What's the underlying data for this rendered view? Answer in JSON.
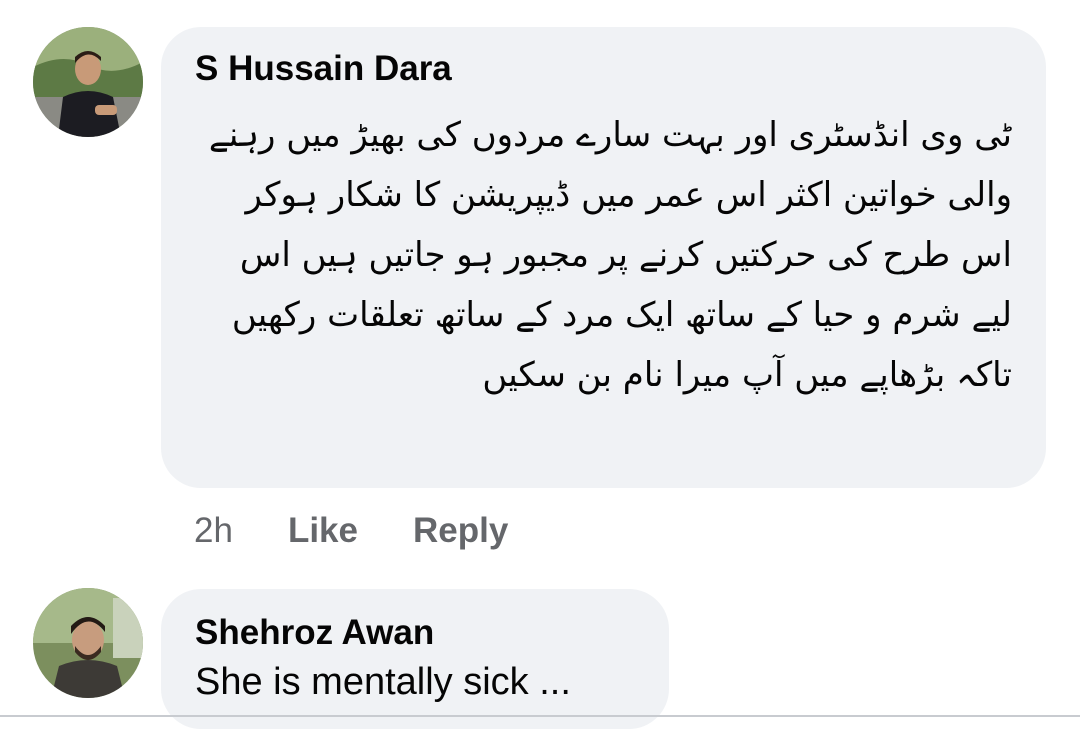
{
  "comments": [
    {
      "author": "S Hussain Dara",
      "text": "ٹی وی انڈسٹری اور بہت سارے مردوں کی بھیڑ میں رہنے والی خواتین اکثر اس عمر میں ڈیپریشن کا شکار ہوکر اس طرح کی حرکتیں کرنے پر مجبور ہو جاتیں ہیں اس لیے شرم و حیا کے ساتھ ایک مرد کے ساتھ تعلقات رکھیں تاکہ بڑھاپے میں آپ میرا نام بن سکیں",
      "time": "2h",
      "like_label": "Like",
      "reply_label": "Reply"
    },
    {
      "author": "Shehroz Awan",
      "text": "She is mentally sick ..."
    }
  ]
}
